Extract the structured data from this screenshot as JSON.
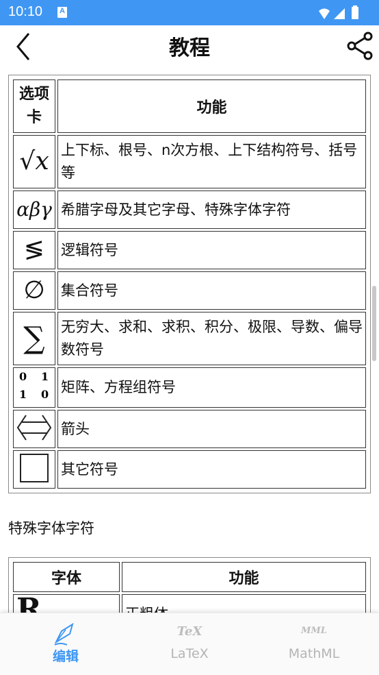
{
  "status_bar": {
    "time": "10:10",
    "notification_icon": "a-notification-icon",
    "wifi_icon": "wifi-icon",
    "signal_icon": "signal-icon",
    "battery_icon": "battery-icon"
  },
  "header": {
    "title": "教程",
    "back_icon": "back-arrow-icon",
    "share_icon": "share-icon"
  },
  "options_table": {
    "headers": [
      "选项卡",
      "功能"
    ],
    "rows": [
      {
        "icon": "sqrt-x-icon",
        "symbol": "√x",
        "desc": "上下标、根号、n次方根、上下结构符号、括号等"
      },
      {
        "icon": "greek-letters-icon",
        "symbol": "αβγ",
        "desc": "希腊字母及其它字母、特殊字体字符"
      },
      {
        "icon": "less-equal-icon",
        "symbol": "≶",
        "desc": "逻辑符号"
      },
      {
        "icon": "empty-set-icon",
        "symbol": "∅",
        "desc": "集合符号"
      },
      {
        "icon": "sigma-icon",
        "symbol": "∑",
        "desc": "无穷大、求和、求积、积分、极限、导数、偏导数符号"
      },
      {
        "icon": "matrix-icon",
        "symbol": "0 1 1 0",
        "desc": "矩阵、方程组符号"
      },
      {
        "icon": "double-arrow-icon",
        "symbol": "⟺",
        "desc": "箭头"
      },
      {
        "icon": "square-icon",
        "symbol": "□",
        "desc": "其它符号"
      }
    ]
  },
  "section_heading": "特殊字体字符",
  "font_table": {
    "headers": [
      "字体",
      "功能"
    ],
    "rows": [
      {
        "icon": "bold-r-icon",
        "symbol": "R",
        "desc": "正粗体"
      }
    ]
  },
  "bottom_nav": {
    "items": [
      {
        "label": "编辑",
        "icon": "pen-nib-icon",
        "active": true
      },
      {
        "label": "LaTeX",
        "icon": "tex-icon",
        "glyph": "TeX",
        "active": false
      },
      {
        "label": "MathML",
        "icon": "mml-icon",
        "glyph": "MML",
        "active": false
      }
    ]
  },
  "colors": {
    "accent": "#3f97f3",
    "inactive": "#b4b4b4"
  }
}
